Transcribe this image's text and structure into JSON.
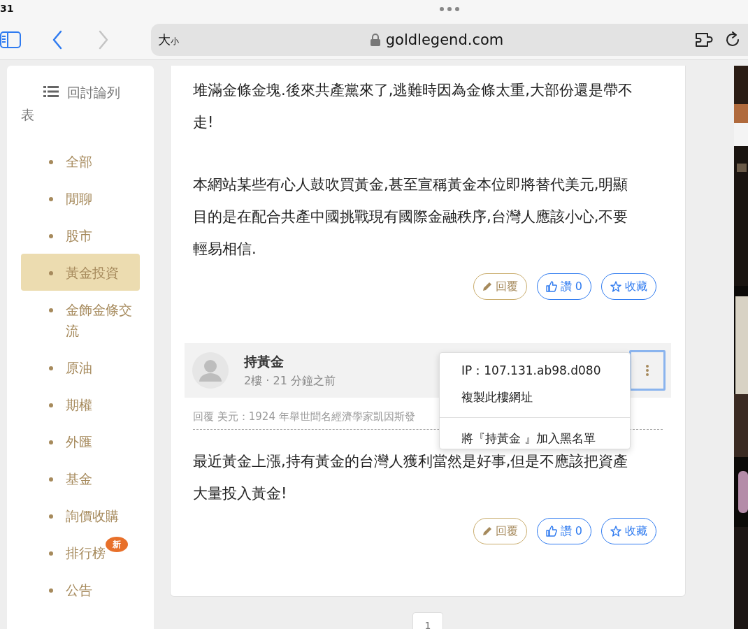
{
  "status_bar": {
    "time": "31"
  },
  "toolbar": {
    "text_size": [
      "大",
      "小"
    ],
    "url": "goldlegend.com",
    "back_enabled": true,
    "forward_enabled": false
  },
  "sidebar": {
    "title": "回討論列表",
    "items": [
      {
        "label": "全部",
        "selected": false
      },
      {
        "label": "閒聊",
        "selected": false
      },
      {
        "label": "股市",
        "selected": false
      },
      {
        "label": "黃金投資",
        "selected": true
      },
      {
        "label": "金飾金條交流",
        "selected": false
      },
      {
        "label": "原油",
        "selected": false
      },
      {
        "label": "期權",
        "selected": false
      },
      {
        "label": "外匯",
        "selected": false
      },
      {
        "label": "基金",
        "selected": false
      },
      {
        "label": "詢價收購",
        "selected": false
      },
      {
        "label": "排行榜",
        "selected": false,
        "badge": "新"
      },
      {
        "label": "公告",
        "selected": false
      }
    ]
  },
  "posts": [
    {
      "paragraphs": [
        [
          "堆滿金條金塊.後來共產黨來了,逃難時因為金條太重,大部份還是帶不",
          "走!"
        ],
        [
          "本網站某些有心人鼓吹買黃金,甚至宣稱黃金本位即將替代美元,明顯",
          "目的是在配合共產中國挑戰現有國際金融秩序,台灣人應該小心,不要",
          "輕易相信."
        ]
      ],
      "actions": [
        {
          "kind": "reply",
          "label": "回覆"
        },
        {
          "kind": "like",
          "label": "讚 0"
        },
        {
          "kind": "favorite",
          "label": "收藏"
        }
      ]
    },
    {
      "author": "持黃金",
      "floor": "2樓 ·",
      "time": "21 分鐘之前",
      "quote": "回覆 美元：1924 年舉世聞名經濟學家凱因斯發",
      "paragraphs": [
        [
          "最近黃金上漲,持有黃金的台灣人獲利當然是好事,但是不應該把資產",
          "大量投入黃金!"
        ]
      ],
      "actions": [
        {
          "kind": "reply",
          "label": "回覆"
        },
        {
          "kind": "like",
          "label": "讚 0"
        },
        {
          "kind": "favorite",
          "label": "收藏"
        }
      ],
      "menu": {
        "items": [
          "IP：107.131.ab98.d080",
          "複製此樓網址",
          "將『持黃金 』加入黑名單"
        ]
      }
    }
  ],
  "pagination": {
    "pages": [
      "1"
    ]
  }
}
